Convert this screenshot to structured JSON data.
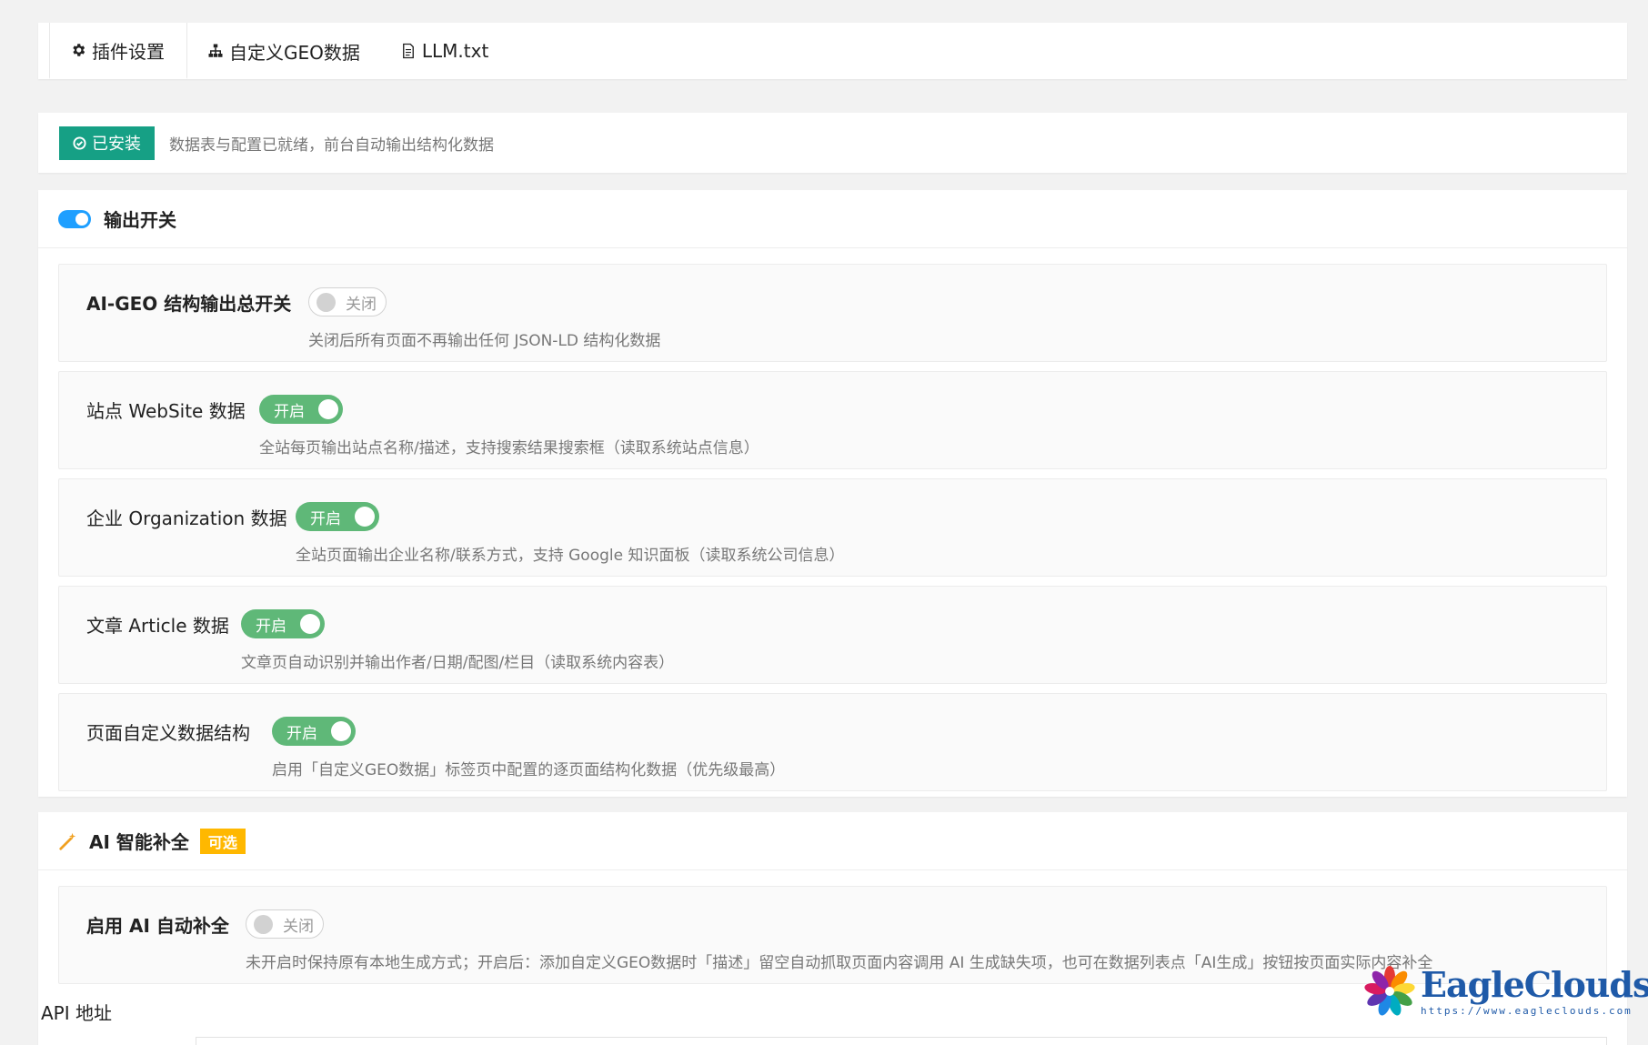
{
  "tabs": [
    {
      "label": "插件设置",
      "icon": "gear-icon"
    },
    {
      "label": "自定义GEO数据",
      "icon": "sitemap-icon"
    },
    {
      "label": "LLM.txt",
      "icon": "file-text-icon"
    }
  ],
  "status": {
    "badge": "已安装",
    "text": "数据表与配置已就绪，前台自动输出结构化数据"
  },
  "output_section": {
    "title": "输出开关",
    "rows": [
      {
        "label": "AI-GEO 结构输出总开关",
        "state": "关闭",
        "enabled": false,
        "desc": "关闭后所有页面不再输出任何 JSON-LD 结构化数据"
      },
      {
        "label": "站点 WebSite 数据",
        "state": "开启",
        "enabled": true,
        "desc": "全站每页输出站点名称/描述，支持搜索结果搜索框（读取系统站点信息）"
      },
      {
        "label": "企业 Organization 数据",
        "state": "开启",
        "enabled": true,
        "desc": "全站页面输出企业名称/联系方式，支持 Google 知识面板（读取系统公司信息）"
      },
      {
        "label": "文章 Article 数据",
        "state": "开启",
        "enabled": true,
        "desc": "文章页自动识别并输出作者/日期/配图/栏目（读取系统内容表）"
      },
      {
        "label": "页面自定义数据结构",
        "state": "开启",
        "enabled": true,
        "desc": "启用「自定义GEO数据」标签页中配置的逐页面结构化数据（优先级最高）"
      }
    ]
  },
  "ai_section": {
    "title": "AI 智能补全",
    "badge": "可选",
    "row": {
      "label": "启用 AI 自动补全",
      "state": "关闭",
      "enabled": false,
      "desc": "未开启时保持原有本地生成方式；开启后：添加自定义GEO数据时「描述」留空自动抓取页面内容调用 AI 生成缺失项，也可在数据列表点「AI生成」按钮按页面实际内容补全"
    },
    "api_label": "API 地址"
  },
  "watermark": {
    "name": "EagleClouds",
    "url": "https://www.eagleclouds.com"
  },
  "colors": {
    "installed": "#16a085",
    "switch_on": "#5fb878",
    "accent_blue": "#1e9fff",
    "optional_badge": "#ffb800"
  }
}
